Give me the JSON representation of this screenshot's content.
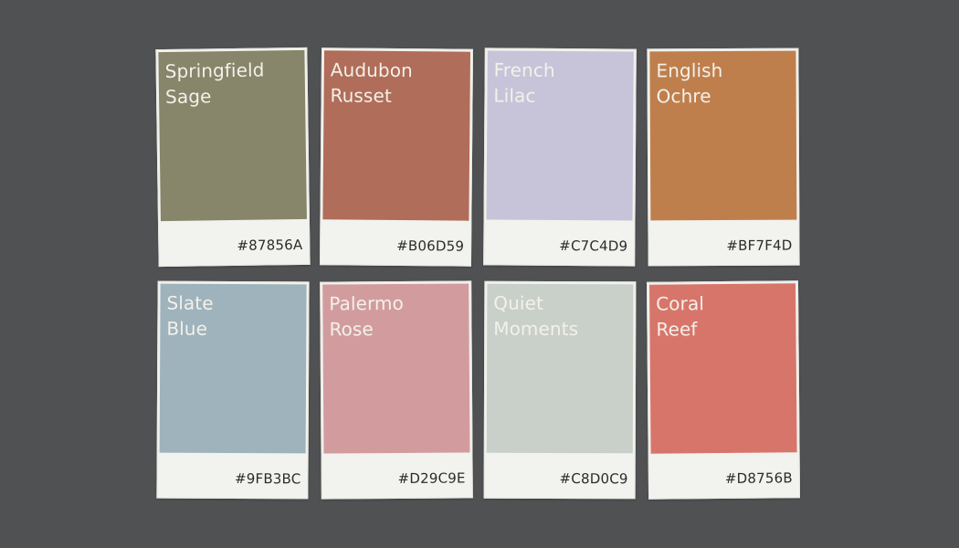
{
  "palette": {
    "cards": [
      {
        "name_line1": "Springfield",
        "name_line2": "Sage",
        "hex": "#87856A",
        "color": "#87856A"
      },
      {
        "name_line1": "Audubon",
        "name_line2": "Russet",
        "hex": "#B06D59",
        "color": "#B06D59"
      },
      {
        "name_line1": "French",
        "name_line2": "Lilac",
        "hex": "#C7C4D9",
        "color": "#C7C4D9"
      },
      {
        "name_line1": "English",
        "name_line2": "Ochre",
        "hex": "#BF7F4D",
        "color": "#BF7F4D"
      },
      {
        "name_line1": "Slate",
        "name_line2": "Blue",
        "hex": "#9FB3BC",
        "color": "#9FB3BC"
      },
      {
        "name_line1": "Palermo",
        "name_line2": "Rose",
        "hex": "#D29C9E",
        "color": "#D29C9E"
      },
      {
        "name_line1": "Quiet",
        "name_line2": "Moments",
        "hex": "#C8D0C9",
        "color": "#C8D0C9"
      },
      {
        "name_line1": "Coral",
        "name_line2": "Reef",
        "hex": "#D8756B",
        "color": "#D8756B"
      }
    ]
  }
}
